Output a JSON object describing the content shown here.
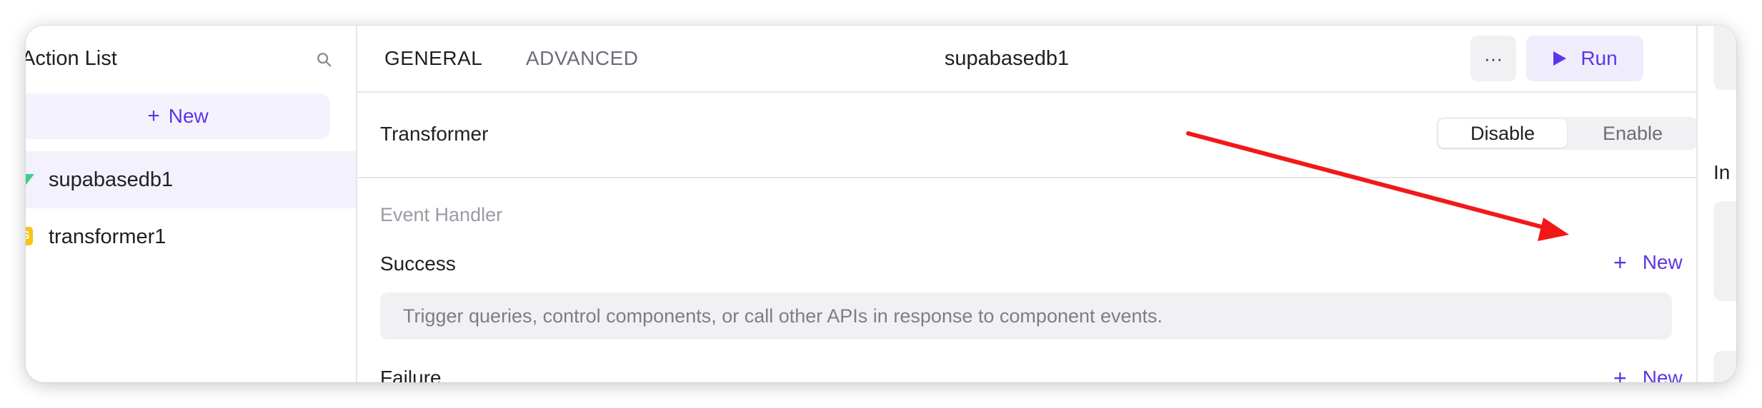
{
  "sidebar": {
    "title": "Action List",
    "new_label": "New",
    "items": [
      {
        "label": "supabasedb1",
        "icon": "supabase-icon",
        "active": true
      },
      {
        "label": "transformer1",
        "icon": "transformer-icon",
        "active": false
      }
    ]
  },
  "header": {
    "tabs": [
      {
        "label": "GENERAL",
        "active": true
      },
      {
        "label": "ADVANCED",
        "active": false
      }
    ],
    "title": "supabasedb1",
    "more_label": "···",
    "run_label": "Run"
  },
  "transformer": {
    "label": "Transformer",
    "options": [
      "Disable",
      "Enable"
    ],
    "selected": "Disable"
  },
  "event_handler": {
    "title": "Event Handler",
    "success_label": "Success",
    "failure_label": "Failure",
    "new_label": "New",
    "hint": "Trigger queries, control components, or call other APIs in response to component events."
  },
  "right_panel": {
    "label": "In"
  },
  "colors": {
    "accent": "#5b36e6",
    "annotation_arrow": "#f21818"
  }
}
